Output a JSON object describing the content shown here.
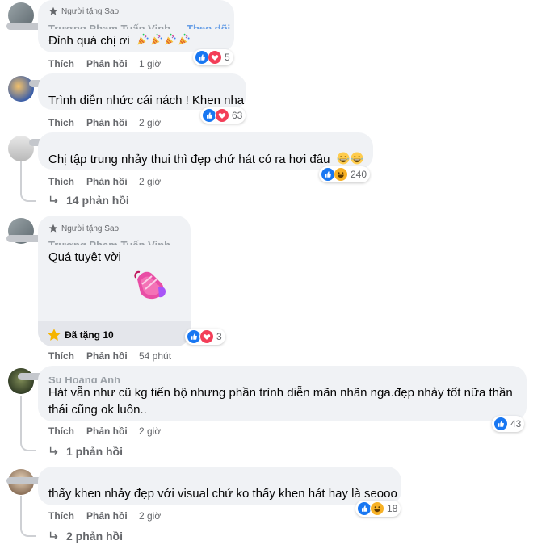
{
  "actions": {
    "like": "Thích",
    "reply": "Phản hồi"
  },
  "comments": [
    {
      "badge": "Người tặng Sao",
      "name": "Trương Phạm Tuấn Vinh",
      "follow": "Theo dõi",
      "text": "Đỉnh quá chị ơi",
      "time": "1 giờ",
      "reactions": {
        "icons": [
          "like",
          "love"
        ],
        "count": "5"
      }
    },
    {
      "text": "Trình diễn nhức cái nách ! Khen nha",
      "time": "2 giờ",
      "reactions": {
        "icons": [
          "like",
          "love"
        ],
        "count": "63"
      }
    },
    {
      "text": "Chị tập trung nhảy thui thì đẹp chứ hát có ra hơi đâu",
      "time": "2 giờ",
      "reactions": {
        "icons": [
          "like",
          "haha"
        ],
        "count": "240"
      },
      "replies": "14 phản hồi"
    },
    {
      "badge": "Người tặng Sao",
      "name": "Trương Phạm Tuấn Vinh",
      "text": "Quá tuyệt vời",
      "stars": "Đã tặng 10",
      "time": "54 phút",
      "reactions": {
        "icons": [
          "like",
          "love"
        ],
        "count": "3"
      }
    },
    {
      "name": "Su Hoàng Anh",
      "text_line1": "Hát vẫn như cũ kg tiến bộ nhưng phần trình diễn mãn nhãn nga.đẹp nhảy tốt nữa thần",
      "text_line2": "thái cũng ok luôn..",
      "time": "2 giờ",
      "reactions": {
        "icons": [
          "like"
        ],
        "count": "43"
      },
      "replies": "1 phản hồi"
    },
    {
      "text": "thấy khen nhảy đẹp với visual chứ ko thấy khen hát hay là seooo",
      "time": "2 giờ",
      "reactions": {
        "icons": [
          "like",
          "haha"
        ],
        "count": "18"
      },
      "replies": "2 phản hồi"
    }
  ],
  "colors": {
    "bubble": "#f0f2f5",
    "meta": "#65676b",
    "like": "#1877f2",
    "love": "#f33e58",
    "haha": "#f7b125"
  }
}
